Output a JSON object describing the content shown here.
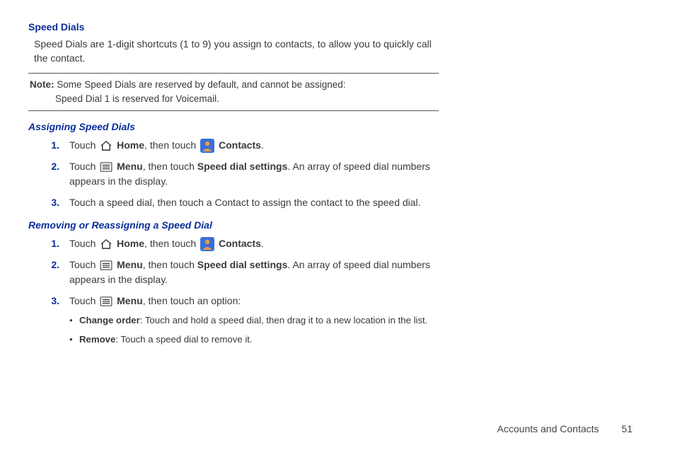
{
  "heading": "Speed Dials",
  "intro": "Speed Dials are 1-digit shortcuts (1 to 9) you assign to contacts, to allow you to quickly call the contact.",
  "note": {
    "label": "Note:",
    "line1": "Some Speed Dials are reserved by default, and cannot be assigned:",
    "line2": "Speed Dial 1 is reserved for Voicemail."
  },
  "sections": [
    {
      "title": "Assigning Speed Dials",
      "steps": [
        {
          "num": "1.",
          "parts": [
            "Touch ",
            {
              "icon": "home"
            },
            " ",
            {
              "b": "Home"
            },
            ", then touch ",
            {
              "icon": "contacts"
            },
            " ",
            {
              "b": "Contacts"
            },
            "."
          ]
        },
        {
          "num": "2.",
          "parts": [
            "Touch ",
            {
              "icon": "menu"
            },
            " ",
            {
              "b": "Menu"
            },
            ", then touch ",
            {
              "b": "Speed dial settings"
            },
            ". An array of speed dial numbers appears in the display."
          ]
        },
        {
          "num": "3.",
          "parts": [
            "Touch a speed dial, then touch a Contact to assign the contact to the speed dial."
          ]
        }
      ]
    },
    {
      "title": "Removing or Reassigning a Speed Dial",
      "steps": [
        {
          "num": "1.",
          "parts": [
            "Touch ",
            {
              "icon": "home"
            },
            " ",
            {
              "b": "Home"
            },
            ", then touch ",
            {
              "icon": "contacts"
            },
            " ",
            {
              "b": "Contacts"
            },
            "."
          ]
        },
        {
          "num": "2.",
          "parts": [
            "Touch ",
            {
              "icon": "menu"
            },
            " ",
            {
              "b": "Menu"
            },
            ", then touch ",
            {
              "b": "Speed dial settings"
            },
            ". An array of speed dial numbers appears in the display."
          ]
        },
        {
          "num": "3.",
          "parts": [
            "Touch ",
            {
              "icon": "menu"
            },
            " ",
            {
              "b": "Menu"
            },
            ", then touch an option:"
          ],
          "bullets": [
            {
              "parts": [
                {
                  "b": "Change order"
                },
                ": Touch and hold a speed dial, then drag it to a new location in the list."
              ]
            },
            {
              "parts": [
                {
                  "b": "Remove"
                },
                ": Touch a speed dial to remove it."
              ]
            }
          ]
        }
      ]
    }
  ],
  "footer": {
    "chapter": "Accounts and Contacts",
    "page": "51"
  },
  "icons": {
    "home": "home-icon",
    "contacts": "contacts-icon",
    "menu": "menu-icon"
  }
}
